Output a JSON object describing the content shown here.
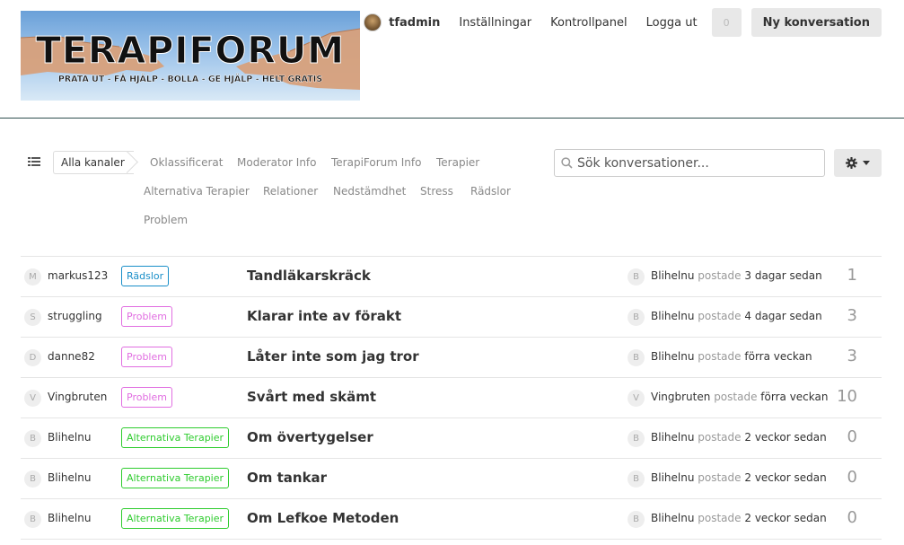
{
  "header": {
    "logo": {
      "title": "TERAPIFORUM",
      "tagline": "PRATA UT - FÅ HJÄLP - BOLLA - GE HJÄLP - HELT GRATIS"
    },
    "user": "tfadmin",
    "links": [
      "Inställningar",
      "Kontrollpanel",
      "Logga ut"
    ],
    "notifications": "0",
    "new_conversation": "Ny konversation"
  },
  "channels": {
    "all": "Alla kanaler",
    "items": [
      "Oklassificerat",
      "Moderator Info",
      "TerapiForum Info",
      "Terapier",
      "Alternativa Terapier",
      "Relationer",
      "Nedstämdhet",
      "Stress",
      "Rädslor",
      "Problem"
    ]
  },
  "search": {
    "placeholder": "Sök konversationer..."
  },
  "colors": {
    "tag_radslor": "#1a8fc9",
    "tag_problem": "#e16ee1",
    "tag_alternativa": "#2ecc2e"
  },
  "conversations": [
    {
      "avatar": "M",
      "author": "markus123",
      "tag": "Rädslor",
      "tag_type": "radslor",
      "title": "Tandläkarskräck",
      "last_avatar": "B",
      "last_user": "Blihelnu",
      "posted": "postade",
      "when": "3 dagar sedan",
      "replies": "1"
    },
    {
      "avatar": "S",
      "author": "struggling",
      "tag": "Problem",
      "tag_type": "problem",
      "title": "Klarar inte av förakt",
      "last_avatar": "B",
      "last_user": "Blihelnu",
      "posted": "postade",
      "when": "4 dagar sedan",
      "replies": "3"
    },
    {
      "avatar": "D",
      "author": "danne82",
      "tag": "Problem",
      "tag_type": "problem",
      "title": "Låter inte som jag tror",
      "last_avatar": "B",
      "last_user": "Blihelnu",
      "posted": "postade",
      "when": "förra veckan",
      "replies": "3"
    },
    {
      "avatar": "V",
      "author": "Vingbruten",
      "tag": "Problem",
      "tag_type": "problem",
      "title": "Svårt med skämt",
      "last_avatar": "V",
      "last_user": "Vingbruten",
      "posted": "postade",
      "when": "förra veckan",
      "replies": "10"
    },
    {
      "avatar": "B",
      "author": "Blihelnu",
      "tag": "Alternativa Terapier",
      "tag_type": "alternativa",
      "title": "Om övertygelser",
      "last_avatar": "B",
      "last_user": "Blihelnu",
      "posted": "postade",
      "when": "2 veckor sedan",
      "replies": "0"
    },
    {
      "avatar": "B",
      "author": "Blihelnu",
      "tag": "Alternativa Terapier",
      "tag_type": "alternativa",
      "title": "Om tankar",
      "last_avatar": "B",
      "last_user": "Blihelnu",
      "posted": "postade",
      "when": "2 veckor sedan",
      "replies": "0"
    },
    {
      "avatar": "B",
      "author": "Blihelnu",
      "tag": "Alternativa Terapier",
      "tag_type": "alternativa",
      "title": "Om Lefkoe Metoden",
      "last_avatar": "B",
      "last_user": "Blihelnu",
      "posted": "postade",
      "when": "2 veckor sedan",
      "replies": "0"
    }
  ]
}
